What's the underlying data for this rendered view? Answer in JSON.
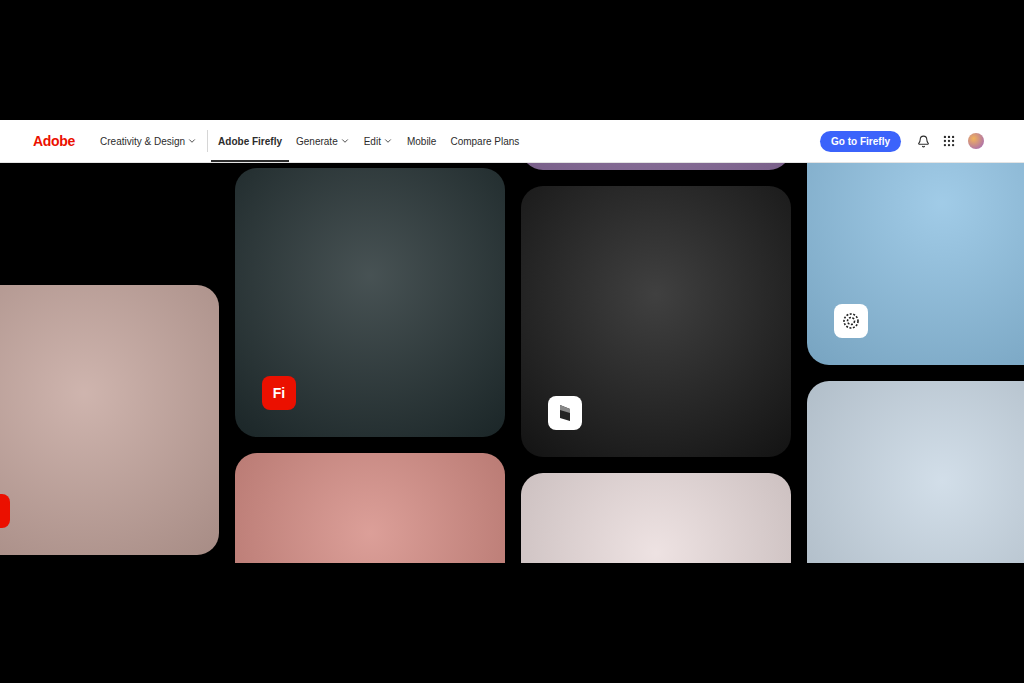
{
  "logo": "Adobe",
  "nav": {
    "menu": {
      "label": "Creativity & Design",
      "dropdown": true
    },
    "items": [
      {
        "label": "Adobe Firefly",
        "dropdown": false,
        "selected": true
      },
      {
        "label": "Generate",
        "dropdown": true,
        "selected": false
      },
      {
        "label": "Edit",
        "dropdown": true,
        "selected": false
      },
      {
        "label": "Mobile",
        "dropdown": false,
        "selected": false
      },
      {
        "label": "Compare Plans",
        "dropdown": false,
        "selected": false
      }
    ],
    "cta": "Go to Firefly"
  },
  "gallery": {
    "columns": [
      {
        "cards": [
          {
            "color": "#c4a49c",
            "badge": {
              "kind": "mark"
            }
          }
        ]
      },
      {
        "cards": [
          {
            "color": "#1f2c2e",
            "badge": {
              "kind": "label",
              "label": "Fi"
            }
          },
          {
            "color": "#d48a82",
            "badge": null
          }
        ]
      },
      {
        "cards": [
          {
            "color": "#8d6fa0",
            "badge": null
          },
          {
            "color": "#161616",
            "badge": {
              "kind": "cube"
            }
          },
          {
            "color": "#eadcdc",
            "badge": null
          }
        ]
      },
      {
        "cards": [
          {
            "color": "#8cc0e2",
            "badge": {
              "kind": "swirl"
            }
          },
          {
            "color": "#c8d7e4",
            "badge": null
          }
        ]
      }
    ]
  }
}
